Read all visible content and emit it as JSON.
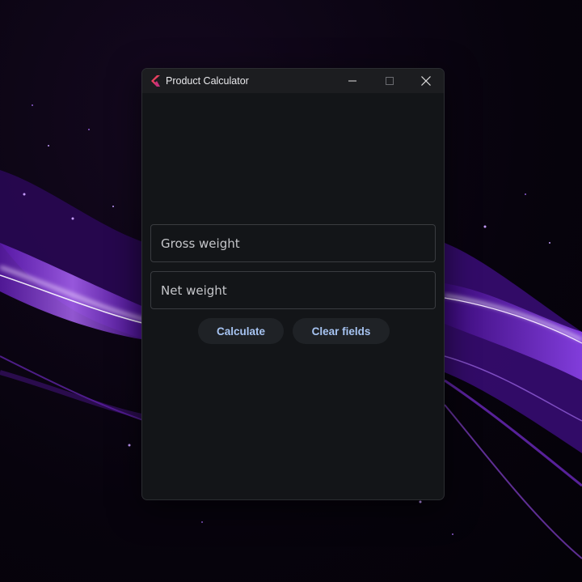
{
  "window": {
    "title": "Product Calculator",
    "icon": "flutter-app-icon",
    "controls": [
      "minimize-icon",
      "maximize-icon",
      "close-icon"
    ]
  },
  "form": {
    "gross_weight_placeholder": "Gross weight",
    "gross_weight_value": "",
    "net_weight_placeholder": "Net weight",
    "net_weight_value": ""
  },
  "buttons": {
    "calculate_label": "Calculate",
    "clear_label": "Clear fields"
  },
  "colors": {
    "window_bg": "#131518",
    "titlebar_bg": "#1c1d20",
    "button_bg": "#1f2226",
    "button_text": "#a7c4f2",
    "wallpaper_accent": "#8a2be2"
  }
}
